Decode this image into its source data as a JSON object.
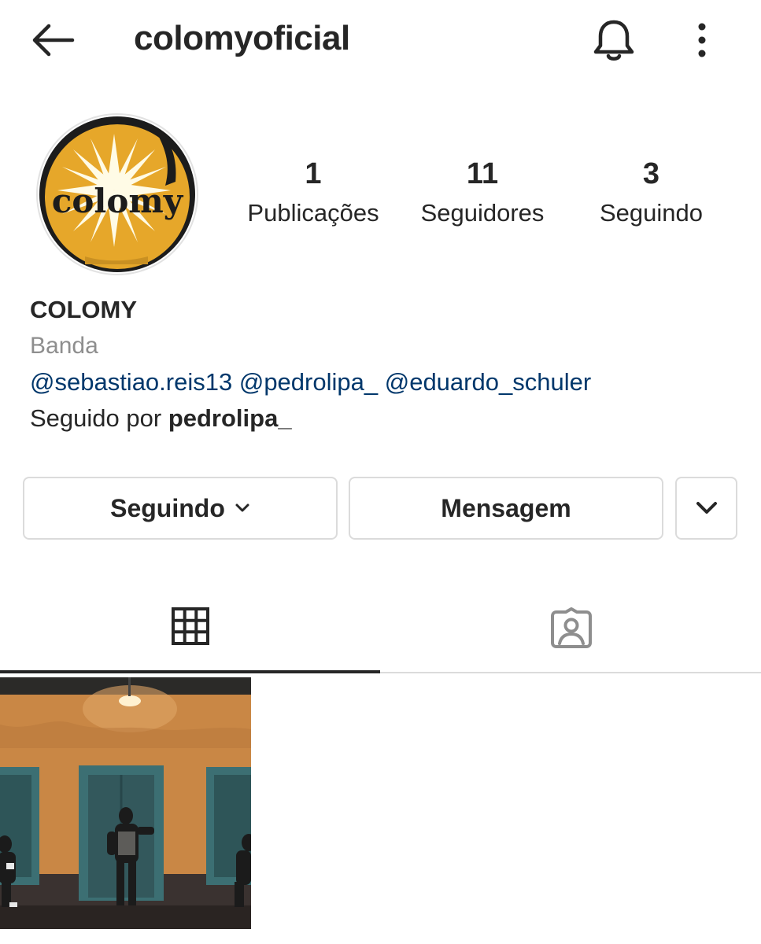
{
  "header": {
    "title": "colomyoficial",
    "icons": {
      "back": "arrow-left-icon",
      "notifications": "bell-icon",
      "more": "more-vertical-icon"
    }
  },
  "profile": {
    "avatar_text": "colomy",
    "stats": {
      "posts": {
        "value": "1",
        "label": "Publicações"
      },
      "followers": {
        "value": "11",
        "label": "Seguidores"
      },
      "following": {
        "value": "3",
        "label": "Seguindo"
      }
    },
    "name": "COLOMY",
    "category": "Banda",
    "mentions": [
      "@sebastiao.reis13",
      "@pedrolipa_",
      "@eduardo_schuler"
    ],
    "followed_by_prefix": "Seguido por",
    "followed_by_user": "pedrolipa_"
  },
  "actions": {
    "following_label": "Seguindo",
    "message_label": "Mensagem",
    "suggestions_icon": "chevron-down-icon"
  },
  "tabs": [
    {
      "name": "posts-grid",
      "icon": "grid-icon",
      "active": true
    },
    {
      "name": "tagged",
      "icon": "tagged-person-icon",
      "active": false
    }
  ],
  "colors": {
    "text": "#262626",
    "muted": "#8e8e8e",
    "link": "#00376b",
    "border": "#dbdbdb",
    "avatar_yellow": "#e6a72a"
  }
}
